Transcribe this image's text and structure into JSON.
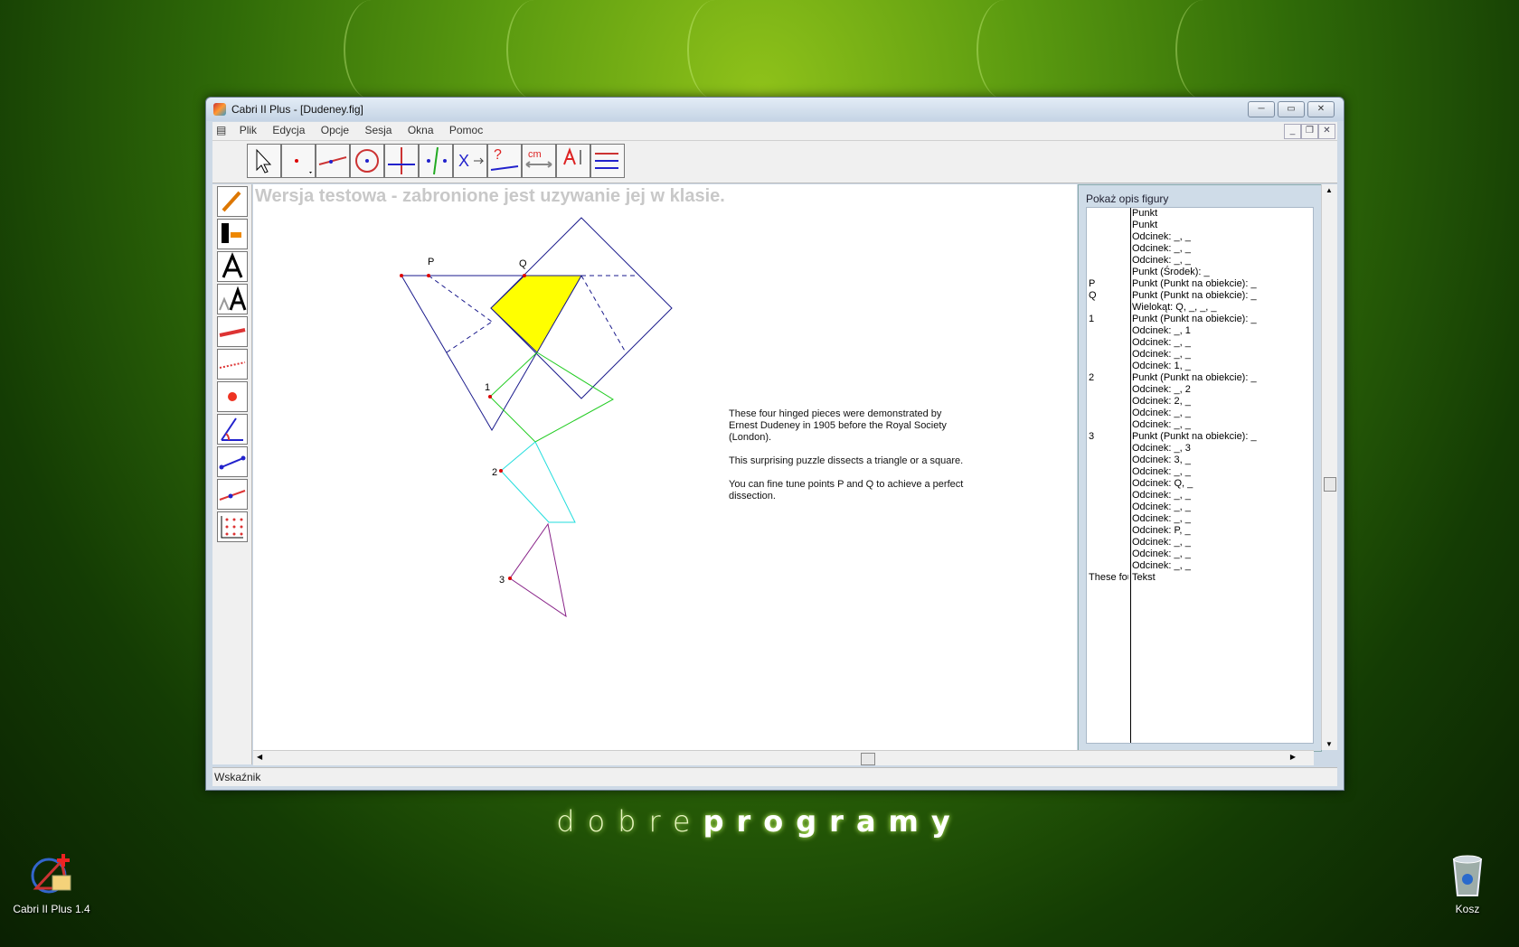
{
  "desktop": {
    "brand_light": "dobre",
    "brand_bold": "programy",
    "icons": [
      {
        "label": "Cabri II Plus 1.4",
        "icon": "cabri-app-icon"
      },
      {
        "label": "Kosz",
        "icon": "recycle-bin-icon"
      }
    ]
  },
  "window": {
    "title": "Cabri II Plus - [Dudeney.fig]",
    "controls": {
      "minimize": "─",
      "maximize": "▭",
      "close": "✕"
    },
    "doc_controls": {
      "minimize": "_",
      "restore": "❐",
      "close": "✕"
    }
  },
  "menu": [
    "Plik",
    "Edycja",
    "Opcje",
    "Sesja",
    "Okna",
    "Pomoc"
  ],
  "toolbar": {
    "tools": [
      "pointer-tool",
      "point-tool",
      "line-tool",
      "circle-tool",
      "construction-tool",
      "transformation-tool",
      "macro-tool",
      "property-tool",
      "measure-tool",
      "text-tool",
      "display-tool"
    ],
    "measure_label": "cm",
    "property_label": "?",
    "macro_label": "X"
  },
  "leftbar": [
    "pencil-tool",
    "fill-tool",
    "text-style-tool",
    "text-size-tool",
    "line-thickness-tool",
    "line-style-tool",
    "point-style-tool",
    "angle-mark-tool",
    "segment-mark-tool",
    "ray-tool",
    "grid-tool"
  ],
  "canvas": {
    "watermark": "Wersja testowa - zabronione jest uzywanie jej w klasie.",
    "labels": {
      "p": "P",
      "q": "Q",
      "one": "1",
      "two": "2",
      "three": "3"
    },
    "description": [
      "These four hinged pieces were demonstrated by Ernest Dudeney in 1905 before the Royal Society (London).",
      "This surprising puzzle dissects a triangle or a square.",
      "You can fine tune points P and Q to achieve a perfect dissection."
    ],
    "colors": {
      "triangle": "#1a1a8c",
      "fill": "#ffff00",
      "piece1": "#22cc22",
      "piece2": "#22dddd",
      "piece3": "#882288",
      "point": "#dd0000"
    }
  },
  "panel": {
    "header": "Pokaż opis figury",
    "rows": [
      {
        "name": "",
        "desc": "Punkt"
      },
      {
        "name": "",
        "desc": "Punkt"
      },
      {
        "name": "",
        "desc": "Odcinek: _, _"
      },
      {
        "name": "",
        "desc": "Odcinek: _, _"
      },
      {
        "name": "",
        "desc": "Odcinek: _, _"
      },
      {
        "name": "",
        "desc": "Punkt (Środek): _"
      },
      {
        "name": "P",
        "desc": "Punkt (Punkt na obiekcie): _"
      },
      {
        "name": "Q",
        "desc": "Punkt (Punkt na obiekcie): _"
      },
      {
        "name": "",
        "desc": "Wielokąt: Q, _, _, _"
      },
      {
        "name": "1",
        "desc": "Punkt (Punkt na obiekcie): _"
      },
      {
        "name": "",
        "desc": "Odcinek: _, 1"
      },
      {
        "name": "",
        "desc": "Odcinek: _, _"
      },
      {
        "name": "",
        "desc": "Odcinek: _, _"
      },
      {
        "name": "",
        "desc": "Odcinek: 1, _"
      },
      {
        "name": "2",
        "desc": "Punkt (Punkt na obiekcie): _"
      },
      {
        "name": "",
        "desc": "Odcinek: _, 2"
      },
      {
        "name": "",
        "desc": "Odcinek: 2, _"
      },
      {
        "name": "",
        "desc": "Odcinek: _, _"
      },
      {
        "name": "",
        "desc": "Odcinek: _, _"
      },
      {
        "name": "3",
        "desc": "Punkt (Punkt na obiekcie): _"
      },
      {
        "name": "",
        "desc": "Odcinek: _, 3"
      },
      {
        "name": "",
        "desc": "Odcinek: 3, _"
      },
      {
        "name": "",
        "desc": "Odcinek: _, _"
      },
      {
        "name": "",
        "desc": "Odcinek: Q, _"
      },
      {
        "name": "",
        "desc": "Odcinek: _, _"
      },
      {
        "name": "",
        "desc": "Odcinek: _, _"
      },
      {
        "name": "",
        "desc": "Odcinek: _, _"
      },
      {
        "name": "",
        "desc": "Odcinek: P, _"
      },
      {
        "name": "",
        "desc": "Odcinek: _, _"
      },
      {
        "name": "",
        "desc": "Odcinek: _, _"
      },
      {
        "name": "",
        "desc": "Odcinek: _, _"
      },
      {
        "name": "These fou",
        "desc": "Tekst"
      }
    ]
  },
  "status": {
    "text": "Wskaźnik"
  }
}
